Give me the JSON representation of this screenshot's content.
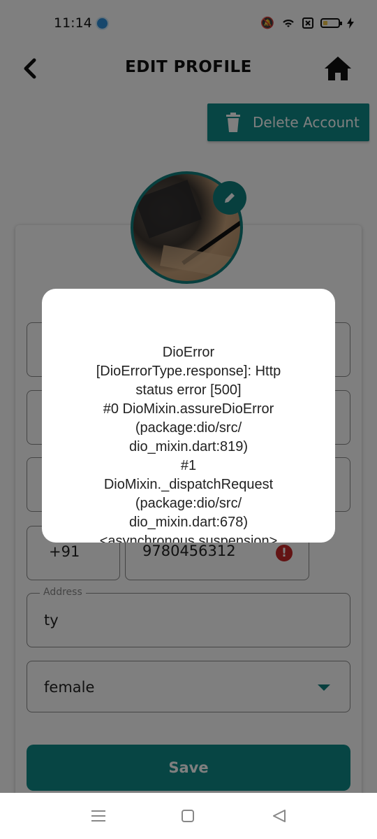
{
  "status_bar": {
    "time": "11:14",
    "icons": [
      "mute-icon",
      "wifi-icon",
      "sim-icon",
      "battery-icon",
      "charging-icon"
    ]
  },
  "header": {
    "title": "EDIT PROFILE",
    "back_icon": "chevron-left-icon",
    "home_icon": "home-icon"
  },
  "delete_account": {
    "label": "Delete Account",
    "icon": "trash-icon"
  },
  "phone": {
    "country_code": "+91",
    "number": "9780456312"
  },
  "address": {
    "label": "Address",
    "value": "ty"
  },
  "gender": {
    "value": "female"
  },
  "save_label": "Save",
  "dialog": {
    "message": "DioError\n[DioErrorType.response]: Http\nstatus error [500]\n#0      DioMixin.assureDioError\n(package:dio/src/\ndio_mixin.dart:819)\n#1\nDioMixin._dispatchRequest\n(package:dio/src/\ndio_mixin.dart:678)\n<asynchronous suspension>"
  },
  "colors": {
    "accent": "#0f8a88",
    "error": "#c62828",
    "overlay": "rgba(0,0,0,0.5)"
  }
}
